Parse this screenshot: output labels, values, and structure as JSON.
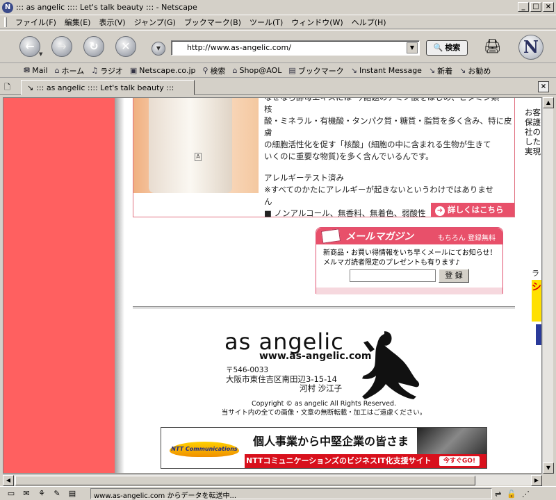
{
  "window": {
    "title": "::: as angelic :::: Let's talk beauty ::: - Netscape"
  },
  "menu": [
    "ファイル(F)",
    "編集(E)",
    "表示(V)",
    "ジャンプ(G)",
    "ブックマーク(B)",
    "ツール(T)",
    "ウィンドウ(W)",
    "ヘルプ(H)"
  ],
  "nav": {
    "url": "http://www.as-angelic.com/",
    "search_label": "検索"
  },
  "personal_toolbar": [
    {
      "label": "Mail",
      "icon": "mail-icon"
    },
    {
      "label": "ホーム",
      "icon": "home-icon"
    },
    {
      "label": "ラジオ",
      "icon": "radio-icon"
    },
    {
      "label": "Netscape.co.jp",
      "icon": "my-icon"
    },
    {
      "label": "検索",
      "icon": "search-icon"
    },
    {
      "label": "Shop@AOL",
      "icon": "shop-icon"
    },
    {
      "label": "ブックマーク",
      "icon": "bookmark-icon"
    },
    {
      "label": "Instant Message",
      "icon": "link-icon"
    },
    {
      "label": "新着",
      "icon": "link-icon"
    },
    {
      "label": "お勧め",
      "icon": "link-icon"
    }
  ],
  "tab": {
    "label": "::: as angelic :::: Let's talk beauty :::"
  },
  "page": {
    "product_text": [
      "なぜなら酵母エキスには\"今話題のアミノ酸をはじめ、ビタミン類・核",
      "酸・ミネラル・有機酸・タンパク質・糖質・脂質を多く含み、特に皮膚",
      "の細胞活性化を促す「核酸」(細胞の中に含まれる生物が生きて",
      "いくのに重要な物質)を多く含んでいるんです。"
    ],
    "allergy_title": "アレルギーテスト済み",
    "allergy_note": "※すべてのかたにアレルギーが起きないというわけではありませ",
    "allergy_note2": "ん",
    "features": "■ ノンアルコール、無香料、無着色、弱酸性",
    "detail_link": "詳しくはこちら",
    "right_col": [
      "お客",
      "保護",
      "社の",
      "した",
      "実現"
    ],
    "mailmag": {
      "title": "メールマガジン",
      "free": "もちろん 登録無料",
      "desc": "新商品・お買い得情報をいち早くメールにてお知らせ！メルマガ読者限定のプレゼントも有ります♪",
      "register": "登 録"
    },
    "rank_label": "ラン",
    "rank_text": "シ",
    "logo": "as angelic",
    "logo_url": "www.as-angelic.com",
    "zip": "〒546-0033",
    "address": "大阪市東住吉区南田辺3-15-14",
    "person": "河村 沙江子",
    "copyright": "Copyright © as angelic All Rights Reserved.",
    "notice": "当サイト内の全ての画像・文章の無断転載・加工はご遠慮ください。",
    "banner": {
      "ntt": "NTT Communications",
      "headline": "個人事業から中堅企業の皆さま",
      "sub": "NTTコミュニケーションズのビジネスIT化支援サイト",
      "go": "今すぐGO!"
    }
  },
  "status": {
    "text": "www.as-angelic.com からデータを転送中..."
  }
}
